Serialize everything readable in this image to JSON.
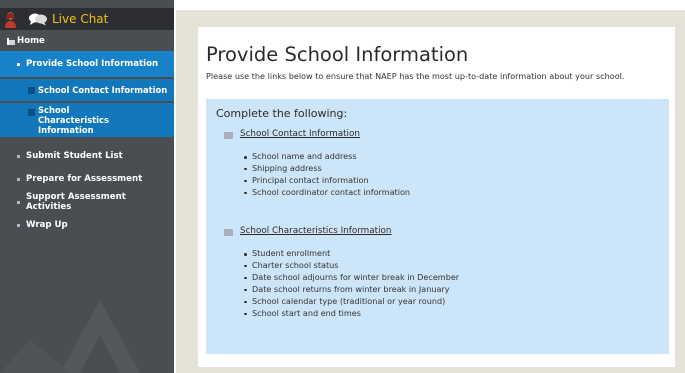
{
  "chat": {
    "label": "Live Chat"
  },
  "nav": {
    "home": "Home",
    "provide": "Provide School Information",
    "sub_contact": "School Contact Information",
    "sub_characteristics": "School Characteristics Information",
    "submit": "Submit Student List",
    "prepare": "Prepare for Assessment",
    "support": "Support Assessment Activities",
    "wrap": "Wrap Up"
  },
  "main": {
    "title": "Provide School Information",
    "intro": "Please use the links below to ensure that NAEP has the most up-to-date information about your school.",
    "panel_heading": "Complete the following:",
    "sections": [
      {
        "link": "School Contact Information",
        "items": [
          "School name and address",
          "Shipping address",
          "Principal contact information",
          "School coordinator contact information"
        ]
      },
      {
        "link": "School Characteristics Information",
        "items": [
          "Student enrollment",
          "Charter school status",
          "Date school adjourns for winter break in December",
          "Date school returns from winter break in January",
          "School calendar type (traditional or year round)",
          "School start and end times"
        ]
      }
    ]
  },
  "colors": {
    "sidebar": "#4a4d52",
    "active": "#1782c9",
    "chat_label": "#f0c31a",
    "panel": "#cde5f8"
  }
}
